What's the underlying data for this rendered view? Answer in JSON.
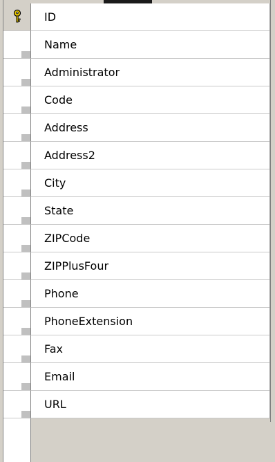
{
  "table": {
    "columns": [
      {
        "name": "ID",
        "primary_key": true,
        "icon": "key-icon"
      },
      {
        "name": "Name"
      },
      {
        "name": "Administrator"
      },
      {
        "name": "Code"
      },
      {
        "name": "Address"
      },
      {
        "name": "Address2"
      },
      {
        "name": "City"
      },
      {
        "name": "State"
      },
      {
        "name": "ZIPCode"
      },
      {
        "name": "ZIPPlusFour"
      },
      {
        "name": "Phone"
      },
      {
        "name": "PhoneExtension"
      },
      {
        "name": "Fax"
      },
      {
        "name": "Email"
      },
      {
        "name": "URL"
      }
    ]
  },
  "colors": {
    "key_icon": "#e8c800",
    "grid_background": "#ffffff",
    "window_background": "#d4d0c8"
  }
}
